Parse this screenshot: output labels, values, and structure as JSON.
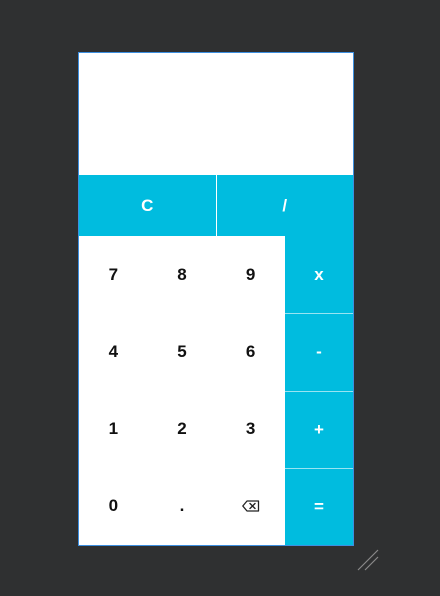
{
  "display": {
    "value": ""
  },
  "top_row": [
    {
      "label": "C",
      "name": "clear-button"
    },
    {
      "label": "/",
      "name": "divide-button"
    }
  ],
  "keypad": {
    "keys": [
      "7",
      "8",
      "9",
      "4",
      "5",
      "6",
      "1",
      "2",
      "3",
      "0",
      "."
    ],
    "backspace_icon": "backspace-icon"
  },
  "operators": [
    "x",
    "-",
    "+",
    "="
  ],
  "colors": {
    "accent": "#00bcdf",
    "background": "#2f3031",
    "window_border": "#3d8fe0"
  }
}
